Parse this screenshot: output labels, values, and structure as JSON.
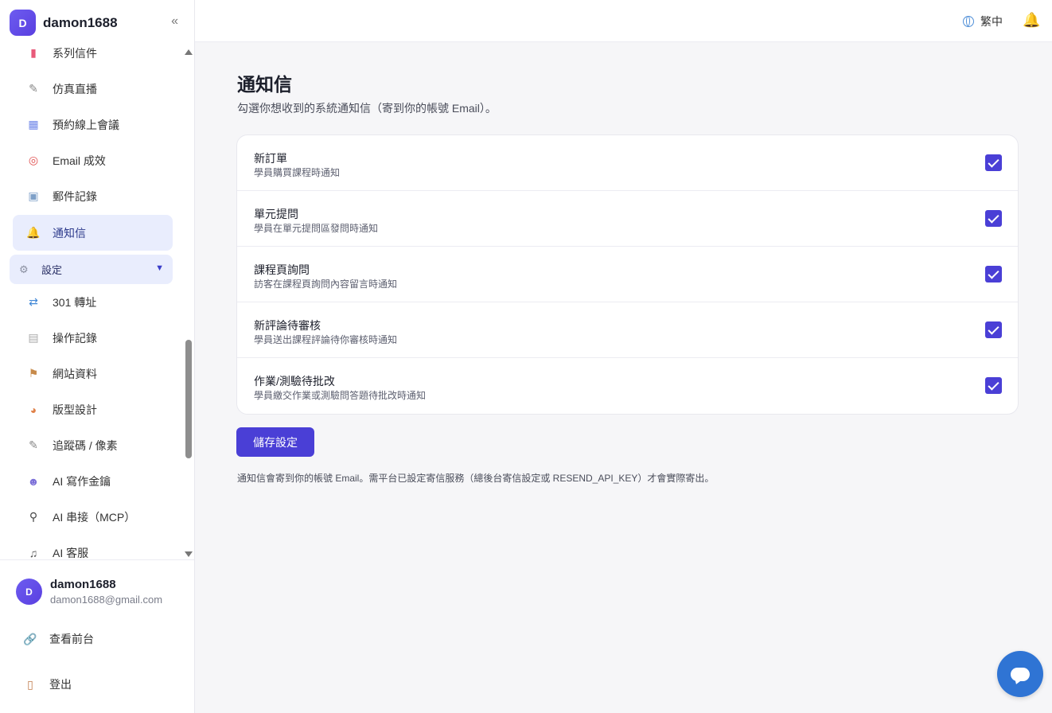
{
  "brand": {
    "initial": "D",
    "name": "damon1688",
    "collapse_icon": "«"
  },
  "sidebar": {
    "items": [
      {
        "icon": "▮",
        "label": "系列信件",
        "icon_color": "#e85a7a"
      },
      {
        "icon": "✎",
        "label": "仿真直播",
        "icon_color": "#888"
      },
      {
        "icon": "▦",
        "label": "預約線上會議",
        "icon_color": "#6f86e8"
      },
      {
        "icon": "◎",
        "label": "Email 成效",
        "icon_color": "#e05050"
      },
      {
        "icon": "▣",
        "label": "郵件記錄",
        "icon_color": "#7ea0c8"
      },
      {
        "icon": "🔔",
        "label": "通知信",
        "icon_color": "#f2b400"
      }
    ],
    "section": {
      "icon": "⚙",
      "label": "設定",
      "caret": "▼"
    },
    "settings_items": [
      {
        "icon": "⇄",
        "label": "301 轉址",
        "icon_color": "#3f87d6"
      },
      {
        "icon": "▤",
        "label": "操作記錄",
        "icon_color": "#aaa"
      },
      {
        "icon": "⚑",
        "label": "網站資料",
        "icon_color": "#c78a4a"
      },
      {
        "icon": "◕",
        "label": "版型設計",
        "icon_color": "#e0824a"
      },
      {
        "icon": "✎",
        "label": "追蹤碼 / 像素",
        "icon_color": "#888"
      },
      {
        "icon": "☻",
        "label": "AI 寫作金鑰",
        "icon_color": "#7b6fd8"
      },
      {
        "icon": "⚲",
        "label": "AI 串接（MCP）",
        "icon_color": "#444"
      },
      {
        "icon": "♫",
        "label": "AI 客服",
        "icon_color": "#555"
      }
    ]
  },
  "user": {
    "initial": "D",
    "name": "damon1688",
    "email": "damon1688@gmail.com"
  },
  "footer_links": [
    {
      "icon": "🔗",
      "label": "查看前台"
    },
    {
      "icon": "▯",
      "label": "登出"
    }
  ],
  "topbar": {
    "language": "繁中",
    "bell_icon": "🔔"
  },
  "main": {
    "title": "通知信",
    "description": "勾選你想收到的系統通知信（寄到你的帳號 Email）。",
    "rows": [
      {
        "title": "新訂單",
        "desc": "學員購買課程時通知",
        "checked": true
      },
      {
        "title": "單元提問",
        "desc": "學員在單元提問區發問時通知",
        "checked": true
      },
      {
        "title": "課程頁詢問",
        "desc": "訪客在課程頁詢問內容留言時通知",
        "checked": true
      },
      {
        "title": "新評論待審核",
        "desc": "學員送出課程評論待你審核時通知",
        "checked": true
      },
      {
        "title": "作業/測驗待批改",
        "desc": "學員繳交作業或測驗問答題待批改時通知",
        "checked": true
      }
    ],
    "save_label": "儲存設定",
    "note": "通知信會寄到你的帳號 Email。需平台已設定寄信服務（總後台寄信設定或 RESEND_API_KEY）才會實際寄出。"
  },
  "colors": {
    "accent": "#4a3fd6",
    "active_bg": "#e9edfd",
    "chat": "#2f74d4"
  }
}
